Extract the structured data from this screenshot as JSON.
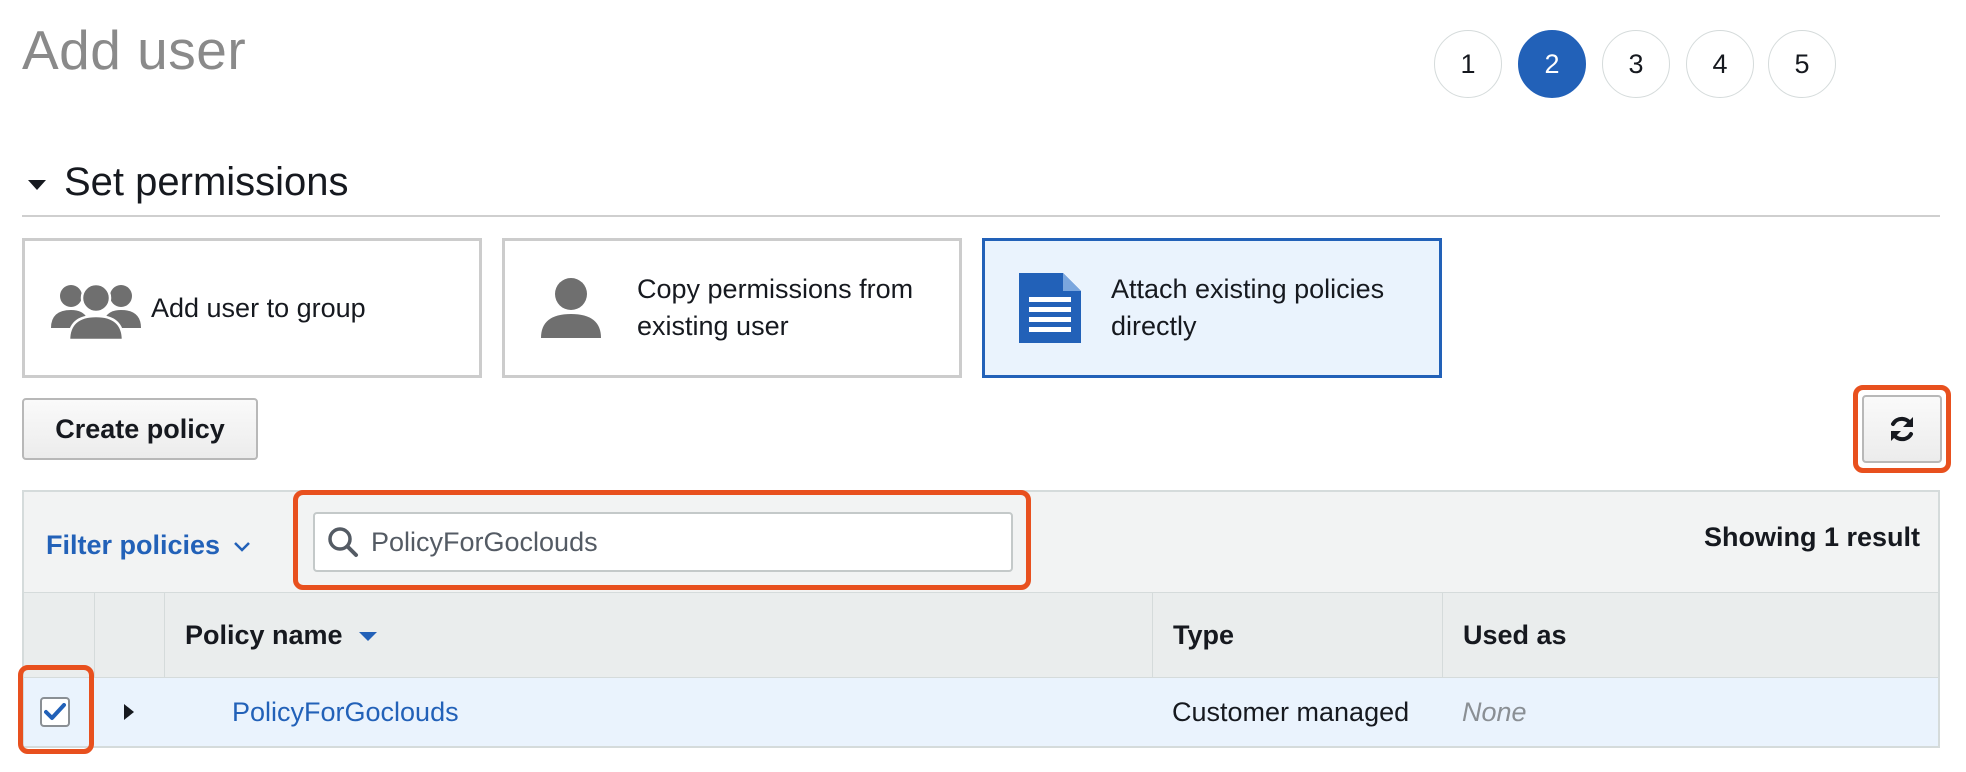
{
  "page": {
    "title": "Add user"
  },
  "steps": [
    {
      "label": "1",
      "active": false
    },
    {
      "label": "2",
      "active": true
    },
    {
      "label": "3",
      "active": false
    },
    {
      "label": "4",
      "active": false
    },
    {
      "label": "5",
      "active": false
    }
  ],
  "section": {
    "title": "Set permissions"
  },
  "options": [
    {
      "label": "Add user to group",
      "icon": "users-group-icon",
      "selected": false
    },
    {
      "label": "Copy permissions from existing user",
      "icon": "user-icon",
      "selected": false
    },
    {
      "label": "Attach existing policies directly",
      "icon": "document-icon",
      "selected": true
    }
  ],
  "toolbar": {
    "create_label": "Create policy",
    "refresh_icon": "refresh-icon"
  },
  "filter": {
    "label": "Filter policies",
    "search_value": "PolicyForGoclouds",
    "result_count": "Showing 1 result"
  },
  "table": {
    "columns": {
      "name": "Policy name",
      "type": "Type",
      "used": "Used as"
    },
    "rows": [
      {
        "name": "PolicyForGoclouds",
        "type": "Customer managed",
        "used": "None",
        "checked": true
      }
    ]
  },
  "colors": {
    "accent": "#2261b8",
    "highlight": "#e8501e",
    "selected_bg": "#eaf3fd"
  }
}
